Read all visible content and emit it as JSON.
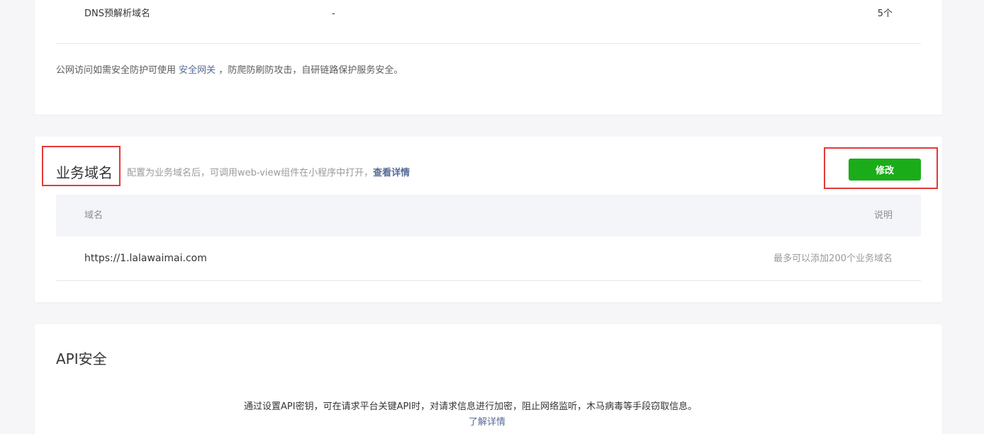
{
  "dns_section": {
    "row": {
      "name": "DNS预解析域名",
      "value": "-",
      "count": "5个"
    },
    "notice_prefix": "公网访问如需安全防护可使用",
    "notice_link": "安全网关",
    "notice_suffix": "，防爬防刷防攻击，自研链路保护服务安全。"
  },
  "business_domain": {
    "title": "业务域名",
    "description": "配置为业务域名后，可调用web-view组件在小程序中打开，",
    "details_link": "查看详情",
    "edit_button": "修改",
    "table": {
      "headers": [
        "域名",
        "说明"
      ],
      "rows": [
        {
          "domain": "https://1.lalawaimai.com",
          "note": "最多可以添加200个业务域名"
        }
      ]
    }
  },
  "api_security": {
    "title": "API安全",
    "text": "通过设置API密钥，可在请求平台关键API时，对请求信息进行加密，阻止网络监听，木马病毒等手段窃取信息。",
    "link": "了解详情"
  },
  "colors": {
    "accent_green": "#1aad19",
    "link_blue": "#576b95",
    "highlight_red": "#e23a3a"
  }
}
